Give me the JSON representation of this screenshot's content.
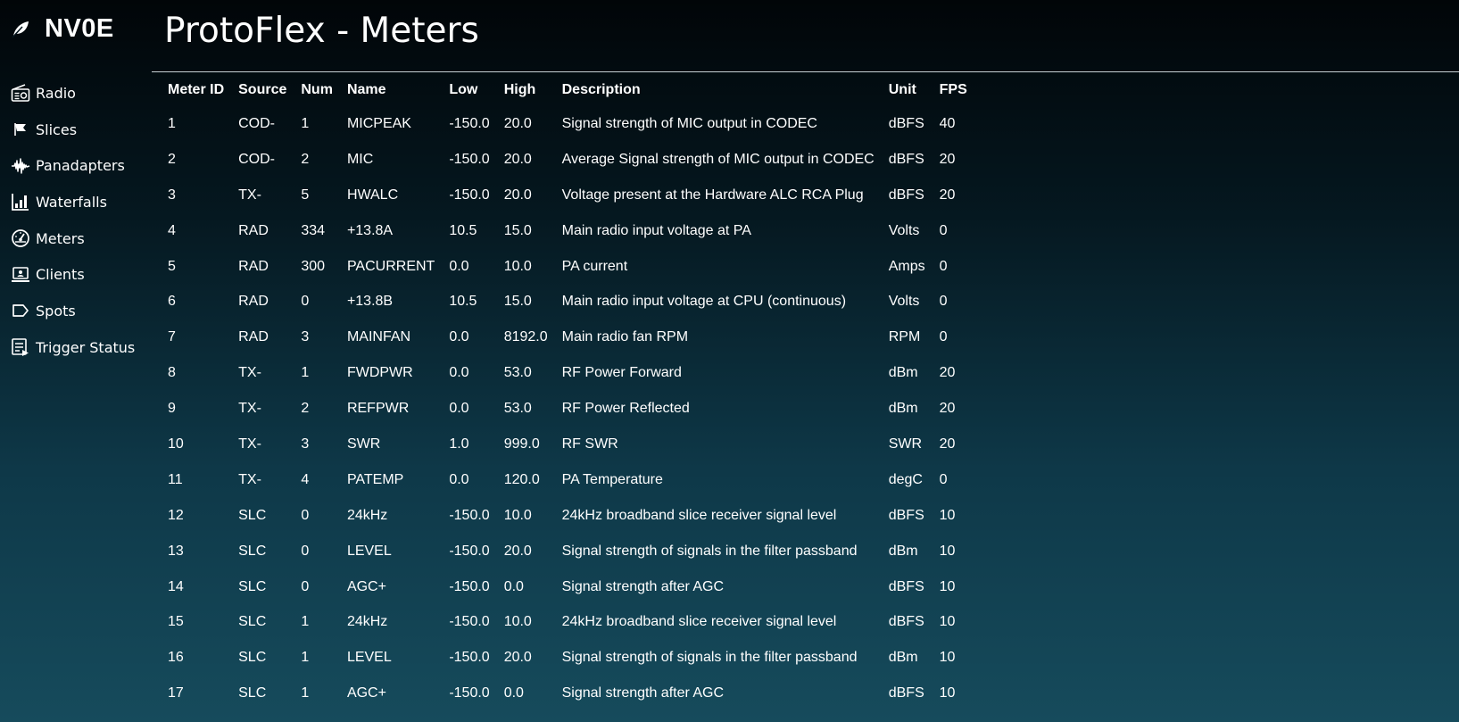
{
  "brand": {
    "name": "NV0E",
    "icon": "leaf-icon"
  },
  "nav": [
    {
      "label": "Radio",
      "icon": "radio-icon"
    },
    {
      "label": "Slices",
      "icon": "flag-icon"
    },
    {
      "label": "Panadapters",
      "icon": "waveform-icon"
    },
    {
      "label": "Waterfalls",
      "icon": "bar-chart-icon"
    },
    {
      "label": "Meters",
      "icon": "speedometer-icon"
    },
    {
      "label": "Clients",
      "icon": "laptop-icon"
    },
    {
      "label": "Spots",
      "icon": "tag-icon"
    },
    {
      "label": "Trigger Status",
      "icon": "list-play-icon"
    }
  ],
  "page": {
    "title": "ProtoFlex - Meters"
  },
  "table": {
    "headers": [
      "Meter ID",
      "Source",
      "Num",
      "Name",
      "Low",
      "High",
      "Description",
      "Unit",
      "FPS"
    ],
    "rows": [
      [
        "1",
        "COD-",
        "1",
        "MICPEAK",
        "-150.0",
        "20.0",
        "Signal strength of MIC output in CODEC",
        "dBFS",
        "40"
      ],
      [
        "2",
        "COD-",
        "2",
        "MIC",
        "-150.0",
        "20.0",
        "Average Signal strength of MIC output in CODEC",
        "dBFS",
        "20"
      ],
      [
        "3",
        "TX-",
        "5",
        "HWALC",
        "-150.0",
        "20.0",
        "Voltage present at the Hardware ALC RCA Plug",
        "dBFS",
        "20"
      ],
      [
        "4",
        "RAD",
        "334",
        "+13.8A",
        "10.5",
        "15.0",
        "Main radio input voltage at PA",
        "Volts",
        "0"
      ],
      [
        "5",
        "RAD",
        "300",
        "PACURRENT",
        "0.0",
        "10.0",
        "PA current",
        "Amps",
        "0"
      ],
      [
        "6",
        "RAD",
        "0",
        "+13.8B",
        "10.5",
        "15.0",
        "Main radio input voltage at CPU (continuous)",
        "Volts",
        "0"
      ],
      [
        "7",
        "RAD",
        "3",
        "MAINFAN",
        "0.0",
        "8192.0",
        "Main radio fan RPM",
        "RPM",
        "0"
      ],
      [
        "8",
        "TX-",
        "1",
        "FWDPWR",
        "0.0",
        "53.0",
        "RF Power Forward",
        "dBm",
        "20"
      ],
      [
        "9",
        "TX-",
        "2",
        "REFPWR",
        "0.0",
        "53.0",
        "RF Power Reflected",
        "dBm",
        "20"
      ],
      [
        "10",
        "TX-",
        "3",
        "SWR",
        "1.0",
        "999.0",
        "RF SWR",
        "SWR",
        "20"
      ],
      [
        "11",
        "TX-",
        "4",
        "PATEMP",
        "0.0",
        "120.0",
        "PA Temperature",
        "degC",
        "0"
      ],
      [
        "12",
        "SLC",
        "0",
        "24kHz",
        "-150.0",
        "10.0",
        "24kHz broadband slice receiver signal level",
        "dBFS",
        "10"
      ],
      [
        "13",
        "SLC",
        "0",
        "LEVEL",
        "-150.0",
        "20.0",
        "Signal strength of signals in the filter passband",
        "dBm",
        "10"
      ],
      [
        "14",
        "SLC",
        "0",
        "AGC+",
        "-150.0",
        "0.0",
        "Signal strength after AGC",
        "dBFS",
        "10"
      ],
      [
        "15",
        "SLC",
        "1",
        "24kHz",
        "-150.0",
        "10.0",
        "24kHz broadband slice receiver signal level",
        "dBFS",
        "10"
      ],
      [
        "16",
        "SLC",
        "1",
        "LEVEL",
        "-150.0",
        "20.0",
        "Signal strength of signals in the filter passband",
        "dBm",
        "10"
      ],
      [
        "17",
        "SLC",
        "1",
        "AGC+",
        "-150.0",
        "0.0",
        "Signal strength after AGC",
        "dBFS",
        "10"
      ]
    ]
  }
}
